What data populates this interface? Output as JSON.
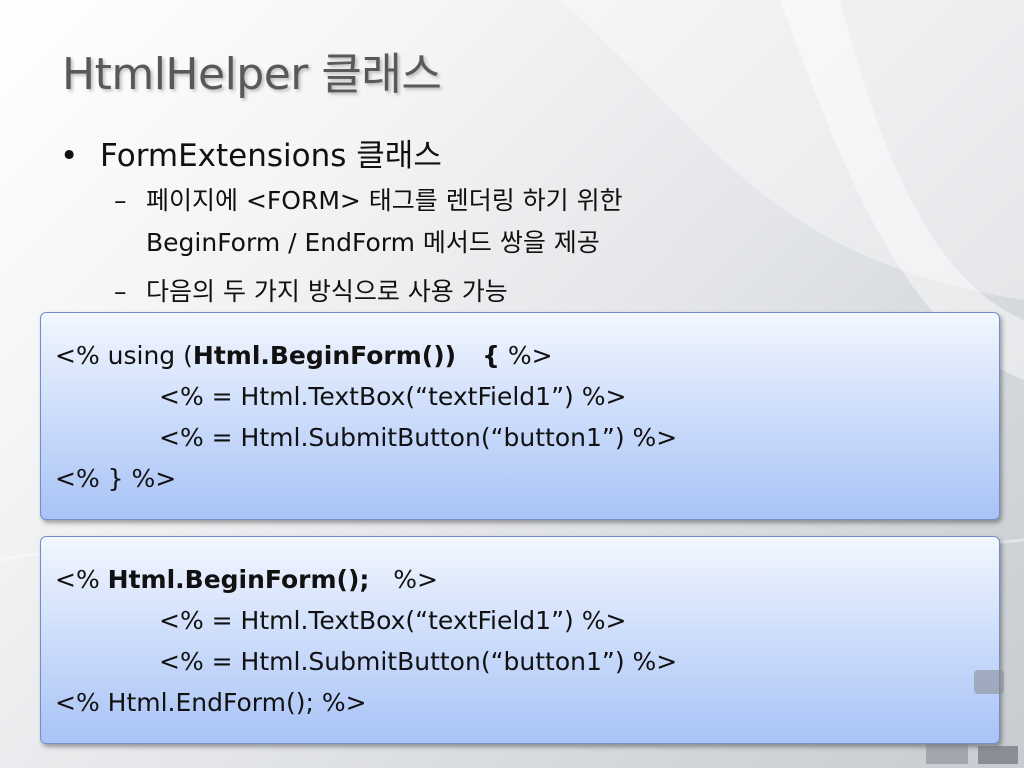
{
  "title": "HtmlHelper 클래스",
  "bullets": {
    "level1": {
      "marker": "•",
      "text": "FormExtensions 클래스"
    },
    "level2": [
      {
        "marker": "–",
        "line1": "페이지에 <FORM> 태그를 렌더링 하기 위한",
        "line2": "BeginForm / EndForm 메서드 쌍을 제공"
      },
      {
        "marker": "–",
        "line1": "다음의 두 가지 방식으로 사용 가능"
      }
    ]
  },
  "code_box_1": {
    "line1_prefix": "<% using (",
    "line1_bold": "Html.BeginForm())   {",
    "line1_suffix": " %>",
    "line2": "<% = Html.TextBox(“textField1”) %>",
    "line3": "<% = Html.SubmitButton(“button1”) %>",
    "line4": "<% } %>"
  },
  "code_box_2": {
    "line1_prefix": "<% ",
    "line1_bold": "Html.BeginForm();",
    "line1_suffix": "   %>",
    "line2": "<% = Html.TextBox(“textField1”) %>",
    "line3": "<% = Html.SubmitButton(“button1”) %>",
    "line4": "<% Html.EndForm(); %>"
  },
  "colors": {
    "title": "#595959",
    "code_box_top": "#f3f7fe",
    "code_box_bottom": "#a9c3f6",
    "code_box_border": "#6f8fc9"
  }
}
